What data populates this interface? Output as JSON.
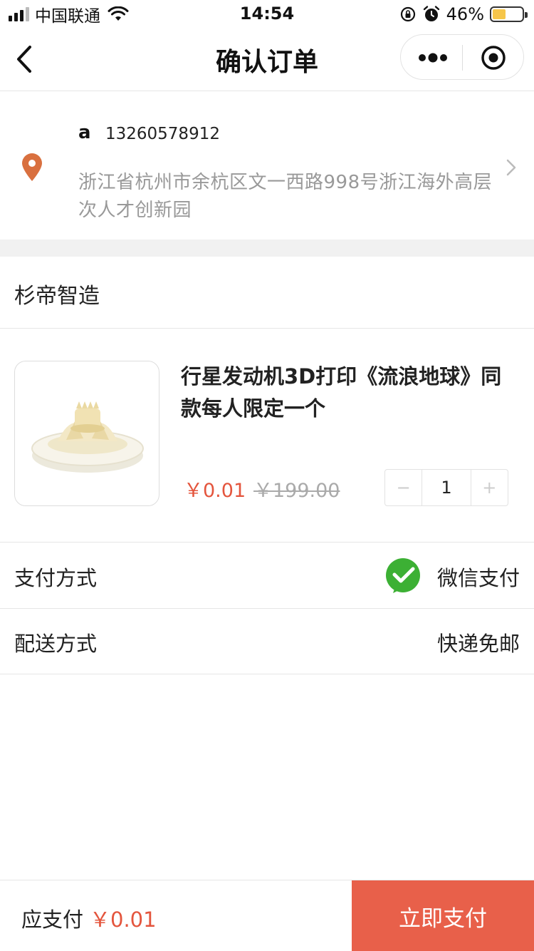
{
  "status_bar": {
    "carrier": "中国联通",
    "time": "14:54",
    "battery_percent_text": "46%",
    "battery_level": 0.46
  },
  "nav": {
    "title": "确认订单"
  },
  "address": {
    "name": "a",
    "phone": "13260578912",
    "detail": "浙江省杭州市余杭区文一西路998号浙江海外高层次人才创新园"
  },
  "shop": {
    "name": "杉帝智造"
  },
  "product": {
    "title": "行星发动机3D打印《流浪地球》同款每人限定一个",
    "price": "￥0.01",
    "original_price": "￥199.00",
    "quantity": "1",
    "minus": "−",
    "plus": "+"
  },
  "payment": {
    "label": "支付方式",
    "value": "微信支付"
  },
  "shipping": {
    "label": "配送方式",
    "value": "快递免邮"
  },
  "footer": {
    "due_label": "应支付",
    "due_amount": "￥0.01",
    "pay_button": "立即支付"
  },
  "colors": {
    "accent": "#e8604a",
    "price": "#e4553d",
    "pin": "#d9703f",
    "wechat": "#3cb034"
  }
}
